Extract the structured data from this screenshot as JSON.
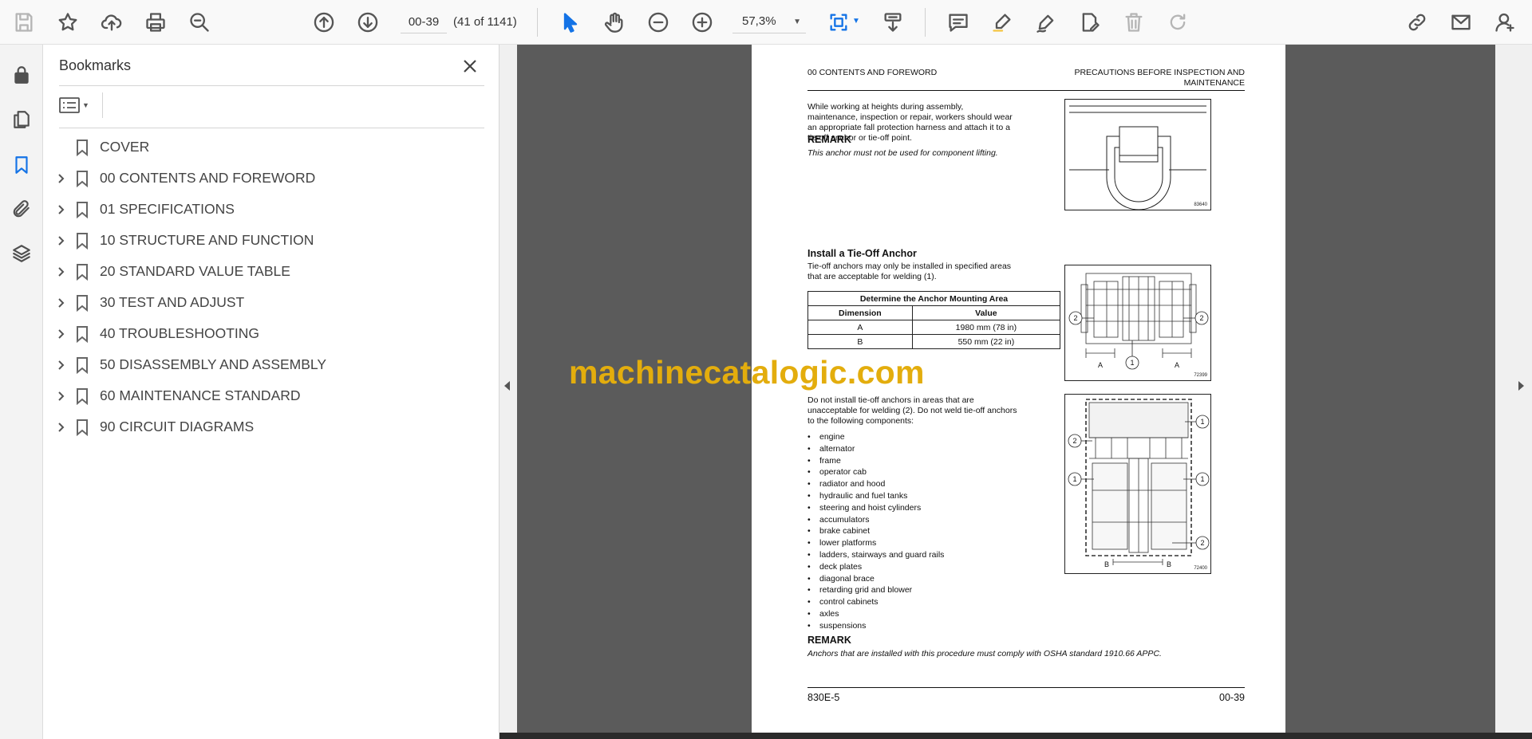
{
  "toolbar": {
    "page_input_value": "00-39",
    "page_count": "(41 of 1141)",
    "zoom_value": "57,3%"
  },
  "panel": {
    "title": "Bookmarks",
    "bookmarks": [
      {
        "label": "COVER",
        "expandable": false
      },
      {
        "label": "00 CONTENTS AND FOREWORD",
        "expandable": true
      },
      {
        "label": "01 SPECIFICATIONS",
        "expandable": true
      },
      {
        "label": "10 STRUCTURE AND FUNCTION",
        "expandable": true
      },
      {
        "label": "20 STANDARD VALUE TABLE",
        "expandable": true
      },
      {
        "label": "30 TEST AND ADJUST",
        "expandable": true
      },
      {
        "label": "40 TROUBLESHOOTING",
        "expandable": true
      },
      {
        "label": "50 DISASSEMBLY AND ASSEMBLY",
        "expandable": true
      },
      {
        "label": "60 MAINTENANCE STANDARD",
        "expandable": true
      },
      {
        "label": "90 CIRCUIT DIAGRAMS",
        "expandable": true
      }
    ]
  },
  "document": {
    "header_left": "00 CONTENTS AND FOREWORD",
    "header_right_line1": "PRECAUTIONS BEFORE INSPECTION AND",
    "header_right_line2": "MAINTENANCE",
    "para1": "While working at heights during assembly, maintenance, inspection or repair, workers should wear an appropriate fall protection harness and attach it to a tie-off anchor or tie-off point.",
    "remark1_title": "REMARK",
    "remark1_text": "This anchor must not be used for component lifting.",
    "fig1_code": "83640",
    "section_heading": "Install a Tie-Off Anchor",
    "para2": "Tie-off anchors may only be installed in specified areas that are acceptable for welding (1).",
    "table": {
      "title": "Determine the Anchor Mounting Area",
      "col_dimension": "Dimension",
      "col_value": "Value",
      "rows": [
        {
          "dimension": "A",
          "value": "1980 mm (78 in)"
        },
        {
          "dimension": "B",
          "value": "550 mm (22 in)"
        }
      ]
    },
    "fig2_code": "72399",
    "fig2_label_1": "1",
    "fig2_label_2": "2",
    "fig2_dim": "A",
    "para3": "Do not install tie-off anchors in areas that are unacceptable for welding (2). Do not weld tie-off anchors to the following components:",
    "components": [
      "engine",
      "alternator",
      "frame",
      "operator cab",
      "radiator and hood",
      "hydraulic and fuel tanks",
      "steering and hoist cylinders",
      "accumulators",
      "brake cabinet",
      "lower platforms",
      "ladders, stairways and guard rails",
      "deck plates",
      "diagonal brace",
      "retarding grid and blower",
      "control cabinets",
      "axles",
      "suspensions"
    ],
    "fig3_code": "72400",
    "fig3_label_1": "1",
    "fig3_label_2": "2",
    "fig3_dim": "B",
    "remark2_title": "REMARK",
    "remark2_text": "Anchors that are installed with this procedure must comply with OSHA standard 1910.66 APPC.",
    "footer_left": "830E-5",
    "footer_right": "00-39"
  },
  "watermark": "machinecatalogic.com",
  "colors": {
    "accent": "#1473e6",
    "watermark": "#e3ad0d",
    "doc_background": "#5b5b5b"
  }
}
